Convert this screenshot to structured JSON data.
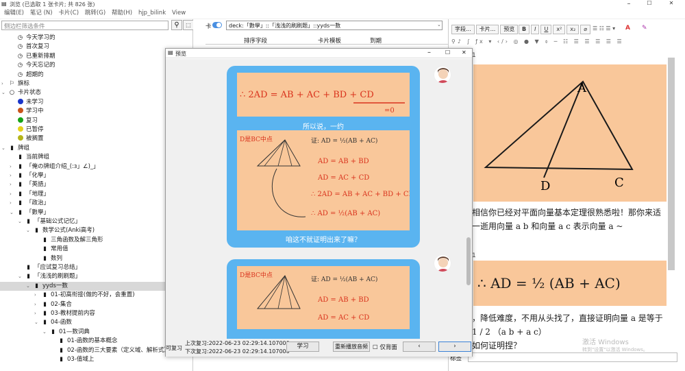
{
  "window": {
    "title": "浏览 (已选取 1 张卡片; 共 826 张)",
    "min": "–",
    "max": "☐",
    "close": "✕"
  },
  "menu": [
    "编辑(E)",
    "笔记 (N)",
    "卡片(C)",
    "跳转(G)",
    "帮助(H)",
    "hjp_bilink",
    "View"
  ],
  "sidebar": {
    "search_placeholder": "侧边栏筛选条件",
    "items": [
      {
        "label": "今天学习的",
        "level": 2,
        "icon": "clock"
      },
      {
        "label": "首次复习",
        "level": 2,
        "icon": "clock"
      },
      {
        "label": "已重新排期",
        "level": 2,
        "icon": "clock"
      },
      {
        "label": "今天忘记的",
        "level": 2,
        "icon": "clock"
      },
      {
        "label": "超期的",
        "level": 2,
        "icon": "clock"
      },
      {
        "label": "旗标",
        "level": 1,
        "icon": "flag",
        "arrow": "›"
      },
      {
        "label": "卡片状态",
        "level": 1,
        "icon": "circle",
        "arrow": "⌄"
      },
      {
        "label": "未学习",
        "level": 2,
        "icon": "dot",
        "color": "#1a35c9"
      },
      {
        "label": "学习中",
        "level": 2,
        "icon": "dot",
        "color": "#c9531a"
      },
      {
        "label": "复习",
        "level": 2,
        "icon": "dot",
        "color": "#17a317"
      },
      {
        "label": "已暂停",
        "level": 2,
        "icon": "dot",
        "color": "#e6d21c"
      },
      {
        "label": "被搁置",
        "level": 2,
        "icon": "dot",
        "color": "#b5b51a"
      },
      {
        "label": "牌组",
        "level": 1,
        "icon": "deck",
        "arrow": "⌄"
      },
      {
        "label": "当前牌组",
        "level": 2,
        "icon": "deck"
      },
      {
        "label": "「俺の牌组介绍_(:з」∠)_」",
        "level": 2,
        "icon": "deck",
        "arrow": "›"
      },
      {
        "label": "「化學」",
        "level": 2,
        "icon": "deck",
        "arrow": "›"
      },
      {
        "label": "「英語」",
        "level": 2,
        "icon": "deck",
        "arrow": "›"
      },
      {
        "label": "「地理」",
        "level": 2,
        "icon": "deck",
        "arrow": "›"
      },
      {
        "label": "「政治」",
        "level": 2,
        "icon": "deck",
        "arrow": "›"
      },
      {
        "label": "「數學」",
        "level": 2,
        "icon": "deck",
        "arrow": "⌄"
      },
      {
        "label": "「基础公式记忆」",
        "level": 3,
        "icon": "deck",
        "arrow": "⌄"
      },
      {
        "label": "数学公式(Anki高考)",
        "level": 4,
        "icon": "deck",
        "arrow": "⌄"
      },
      {
        "label": "三角函数及解三角形",
        "level": 5,
        "icon": "deck"
      },
      {
        "label": "常用值",
        "level": 5,
        "icon": "deck"
      },
      {
        "label": "数列",
        "level": 5,
        "icon": "deck"
      },
      {
        "label": "「应试复习总结」",
        "level": 3,
        "icon": "deck"
      },
      {
        "label": "「浅浅的刷刷题」",
        "level": 3,
        "icon": "deck",
        "arrow": "⌄"
      },
      {
        "label": "yyds一数",
        "level": 4,
        "icon": "deck",
        "arrow": "⌄",
        "selected": true
      },
      {
        "label": "01-初高衔接(做的不好，会重置)",
        "level": 5,
        "icon": "deck",
        "arrow": "›"
      },
      {
        "label": "02-集合",
        "level": 5,
        "icon": "deck",
        "arrow": "›"
      },
      {
        "label": "03-教材提前内容",
        "level": 5,
        "icon": "deck",
        "arrow": "›"
      },
      {
        "label": "04-函数",
        "level": 5,
        "icon": "deck",
        "arrow": "⌄"
      },
      {
        "label": "01—数词典",
        "level": 6,
        "icon": "deck",
        "arrow": "⌄"
      },
      {
        "label": "01-函数的基本概念",
        "level": 7,
        "icon": "deck"
      },
      {
        "label": "02-函数的三大要素（定义域、解析式）",
        "level": 7,
        "icon": "deck"
      },
      {
        "label": "03-值域上",
        "level": 7,
        "icon": "deck"
      }
    ]
  },
  "browser": {
    "toggle_label": "卡",
    "search_value": "deck:「數學」::「浅浅的刷刷题」::yyds一数",
    "columns": [
      "排序字段",
      "卡片模板",
      "到期"
    ],
    "bottom_prev_label": "下次复习"
  },
  "editor": {
    "buttons": [
      "字段...",
      "卡片...",
      "预览"
    ],
    "fmt": [
      "B",
      "I",
      "U",
      "x²",
      "x₂",
      "⌀"
    ],
    "tags_label": "标签",
    "text1": "相信你已经对平面向量基本定理很熟悉啦！那你来适一逝用向量 a b 和向量 a c 表示向量 a ~",
    "text2": "，降低难度，不用从头找了，直接证明向量 a 是等于 1 / 2 （a b + a c）",
    "text3": "如何证明捏？",
    "num1": "1",
    "num2": "1"
  },
  "preview": {
    "title": "预览",
    "caption1": "所以说，一约",
    "caption2": "咱这不就证明出来了嘛？",
    "formula_top": "∴ 2AD = AB + AC + BD + CD",
    "last_review": "上次复习:2022-06-23 02:29:14.107000",
    "next_review": "下次复习:2022-06-23 02:29:14.107000",
    "left_label1": "可复习",
    "btn_study": "学习",
    "btn_replay": "重新播放音频",
    "chk_back": "仅背面",
    "btn_prev": "‹",
    "btn_next": "›"
  },
  "watermark": {
    "line1": "激活 Windows",
    "line2": "转到\"设置\"以激活 Windows。"
  }
}
